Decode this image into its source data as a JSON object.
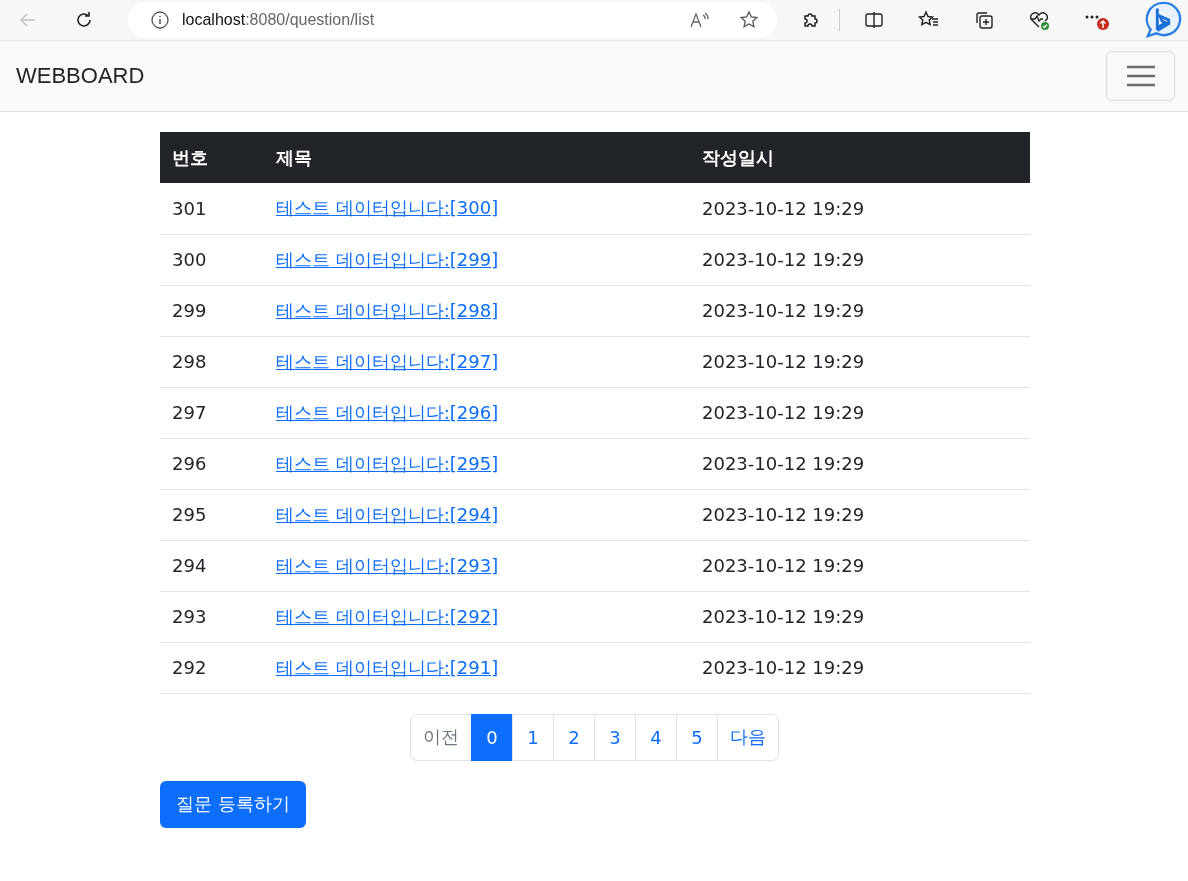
{
  "browser": {
    "address": {
      "host": "localhost",
      "path": ":8080/question/list"
    },
    "back_disabled": true
  },
  "navbar": {
    "brand": "WEBBOARD"
  },
  "table": {
    "columns": [
      "번호",
      "제목",
      "작성일시"
    ],
    "rows": [
      {
        "number": "301",
        "title": "테스트 데이터입니다:[300]",
        "date": "2023-10-12 19:29"
      },
      {
        "number": "300",
        "title": "테스트 데이터입니다:[299]",
        "date": "2023-10-12 19:29"
      },
      {
        "number": "299",
        "title": "테스트 데이터입니다:[298]",
        "date": "2023-10-12 19:29"
      },
      {
        "number": "298",
        "title": "테스트 데이터입니다:[297]",
        "date": "2023-10-12 19:29"
      },
      {
        "number": "297",
        "title": "테스트 데이터입니다:[296]",
        "date": "2023-10-12 19:29"
      },
      {
        "number": "296",
        "title": "테스트 데이터입니다:[295]",
        "date": "2023-10-12 19:29"
      },
      {
        "number": "295",
        "title": "테스트 데이터입니다:[294]",
        "date": "2023-10-12 19:29"
      },
      {
        "number": "294",
        "title": "테스트 데이터입니다:[293]",
        "date": "2023-10-12 19:29"
      },
      {
        "number": "293",
        "title": "테스트 데이터입니다:[292]",
        "date": "2023-10-12 19:29"
      },
      {
        "number": "292",
        "title": "테스트 데이터입니다:[291]",
        "date": "2023-10-12 19:29"
      }
    ]
  },
  "pagination": [
    {
      "label": "이전",
      "selected": false,
      "disabled": true
    },
    {
      "label": "0",
      "selected": true,
      "disabled": false
    },
    {
      "label": "1",
      "selected": false,
      "disabled": false
    },
    {
      "label": "2",
      "selected": false,
      "disabled": false
    },
    {
      "label": "3",
      "selected": false,
      "disabled": false
    },
    {
      "label": "4",
      "selected": false,
      "disabled": false
    },
    {
      "label": "5",
      "selected": false,
      "disabled": false
    },
    {
      "label": "다음",
      "selected": false,
      "disabled": false
    }
  ],
  "create_button": "질문 등록하기"
}
